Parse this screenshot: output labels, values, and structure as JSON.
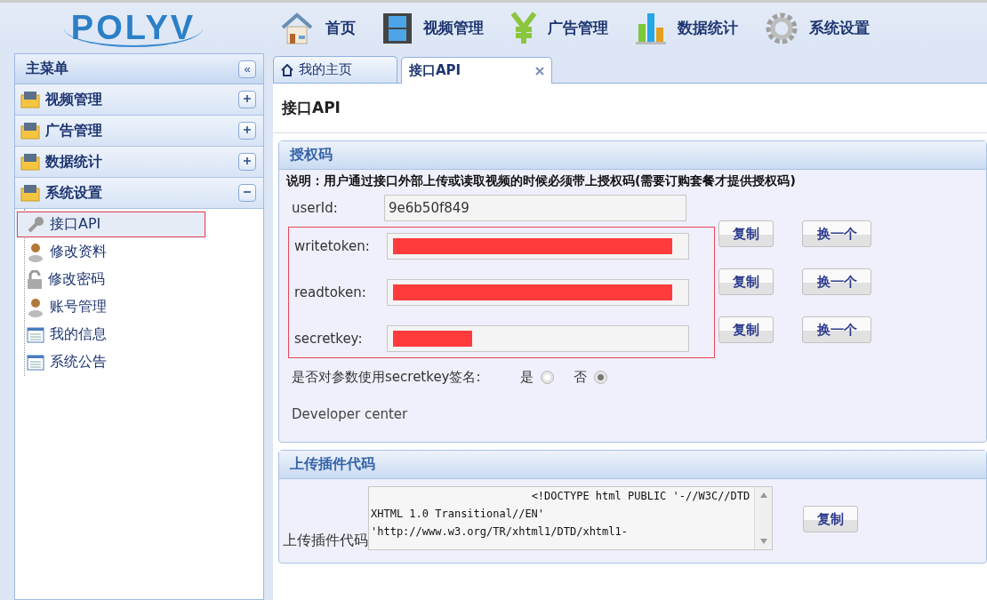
{
  "logo": {
    "text": "POLYV"
  },
  "top_nav": [
    {
      "label": "首页"
    },
    {
      "label": "视频管理"
    },
    {
      "label": "广告管理"
    },
    {
      "label": "数据统计"
    },
    {
      "label": "系统设置"
    }
  ],
  "sidebar": {
    "title": "主菜单",
    "collapse_glyph": "«",
    "groups": [
      {
        "label": "视频管理",
        "expanded": false
      },
      {
        "label": "广告管理",
        "expanded": false
      },
      {
        "label": "数据统计",
        "expanded": false
      },
      {
        "label": "系统设置",
        "expanded": true,
        "children": [
          {
            "label": "接口API",
            "selected": true
          },
          {
            "label": "修改资料",
            "selected": false
          },
          {
            "label": "修改密码",
            "selected": false
          },
          {
            "label": "账号管理",
            "selected": false
          },
          {
            "label": "我的信息",
            "selected": false
          },
          {
            "label": "系统公告",
            "selected": false
          }
        ]
      }
    ]
  },
  "tabs": [
    {
      "label": "我的主页",
      "selected": false
    },
    {
      "label": "接口API",
      "selected": true
    }
  ],
  "page_title": "接口API",
  "auth_panel": {
    "title": "授权码",
    "note": "说明：用户通过接口外部上传或读取视频的时候必须带上授权码(需要订购套餐才提供授权码)",
    "userid": {
      "label": "userId:",
      "value": "9e6b50f849"
    },
    "highlighted": true,
    "tokens": [
      {
        "label": "writetoken:",
        "buttons": [
          "复制",
          "换一个"
        ]
      },
      {
        "label": "readtoken:",
        "buttons": [
          "复制",
          "换一个"
        ]
      },
      {
        "label": "secretkey:",
        "buttons": [
          "复制",
          "换一个"
        ]
      }
    ],
    "sign_question": "是否对参数使用secretkey签名:",
    "sign_options": [
      {
        "label": "是",
        "selected": false
      },
      {
        "label": "否",
        "selected": true
      }
    ],
    "developer_link": "Developer center"
  },
  "plugin_panel": {
    "title": "上传插件代码",
    "label": "上传插件代码",
    "code": "                         <!DOCTYPE html PUBLIC '-//W3C//DTD XHTML 1.0 Transitional//EN' 'http://www.w3.org/TR/xhtml1/DTD/xhtml1-",
    "button": "复制"
  }
}
